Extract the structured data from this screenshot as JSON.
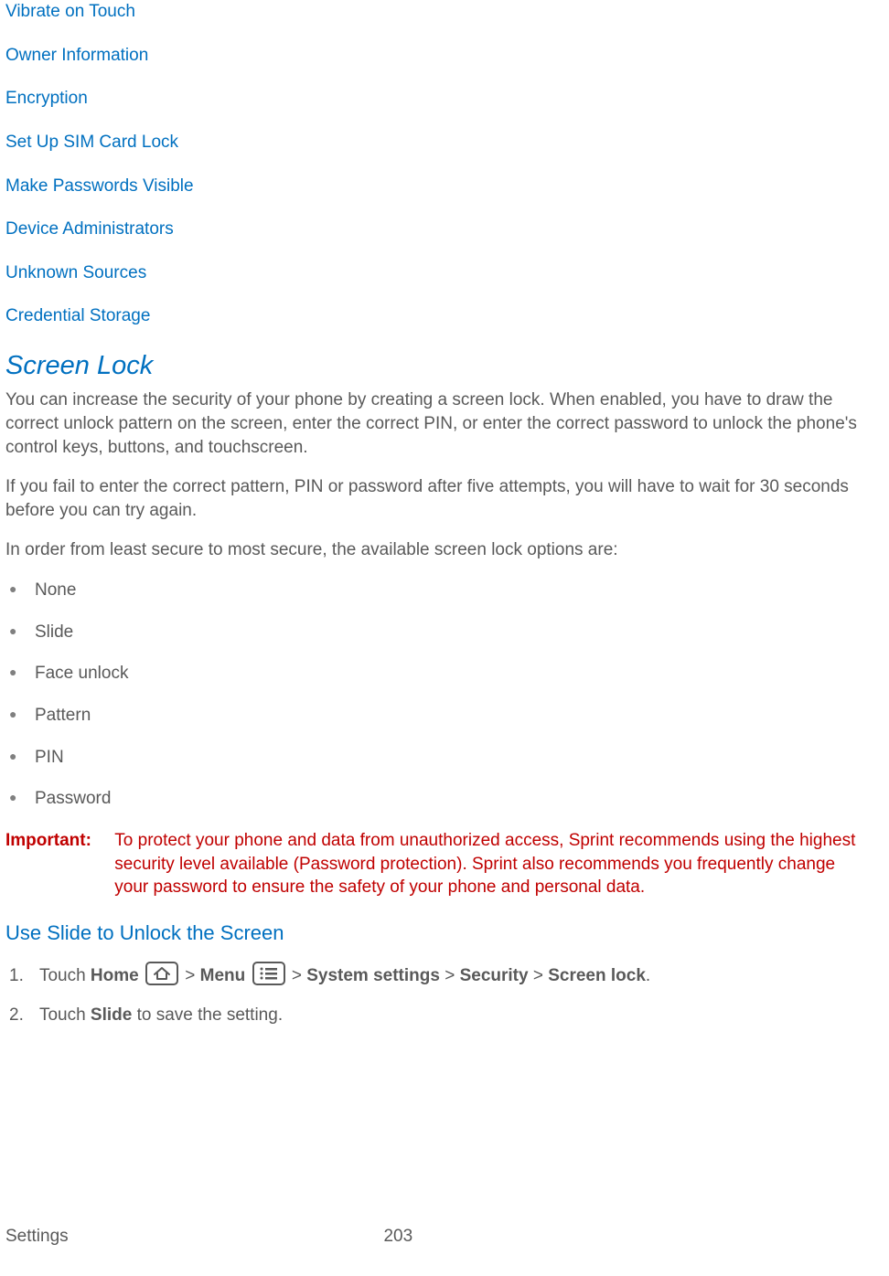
{
  "links": [
    "Vibrate on Touch",
    "Owner Information",
    "Encryption",
    "Set Up SIM Card Lock",
    "Make Passwords Visible",
    "Device Administrators",
    "Unknown Sources",
    "Credential Storage"
  ],
  "heading": "Screen Lock",
  "para1": "You can increase the security of your phone by creating a screen lock. When enabled, you have to draw the correct unlock pattern on the screen, enter the correct PIN, or enter the correct password to unlock the phone's control keys, buttons, and touchscreen.",
  "para2": "If you fail to enter the correct pattern, PIN or password after five attempts, you will have to wait for 30 seconds before you can try again.",
  "para3": "In order from least secure to most secure, the available screen lock options are:",
  "options": [
    "None",
    "Slide",
    "Face unlock",
    "Pattern",
    "PIN",
    "Password"
  ],
  "important_label": "Important:",
  "important_text": "To protect your phone and data from unauthorized access, Sprint recommends using the highest security level available (Password protection). Sprint also recommends you frequently change your password to ensure the safety of your phone and personal data.",
  "sub_heading": "Use Slide to Unlock the Screen",
  "step1": {
    "prefix": "Touch ",
    "home": "Home",
    "gt1": " > ",
    "menu": "Menu",
    "gt2": " > ",
    "syssettings": "System settings",
    "gt3": " > ",
    "security": "Security",
    "gt4": " > ",
    "screenlock": "Screen lock",
    "period": "."
  },
  "step2": {
    "prefix": "Touch ",
    "slide": "Slide",
    "suffix": " to save the setting."
  },
  "footer_left": "Settings",
  "footer_page": "203"
}
